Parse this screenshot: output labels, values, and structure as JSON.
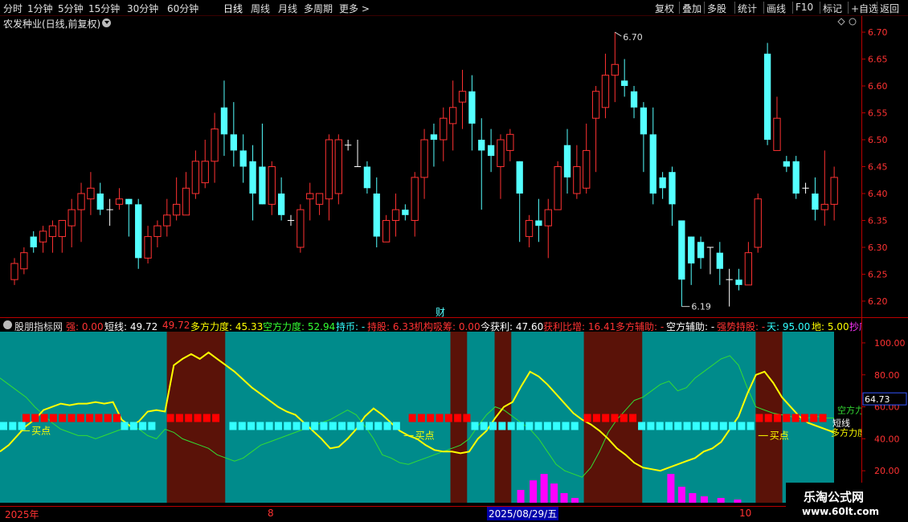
{
  "nav": [
    "分时",
    "1分钟",
    "5分钟",
    "15分钟",
    "30分钟",
    "60分钟",
    "日线",
    "周线",
    "月线",
    "多周期",
    "更多 >"
  ],
  "nav_active": "日线",
  "toolbar": [
    "复权",
    "叠加",
    "多股",
    "统计",
    "画线",
    "F10",
    "标记",
    "+自选",
    "返回"
  ],
  "stock_title": "农发种业(日线,前复权)",
  "price_axis": [
    "6.70",
    "6.65",
    "6.60",
    "6.55",
    "6.50",
    "6.45",
    "6.40",
    "6.35",
    "6.30",
    "6.25",
    "6.20"
  ],
  "price_annotations": {
    "high": "6.70",
    "low": "6.19"
  },
  "cai_marker": "财",
  "indicator_title": [
    {
      "text": "股朋指标网",
      "color": "#e0e0e0"
    },
    {
      "text": "强: 0.00",
      "color": "#ff3333"
    },
    {
      "text": "短线: 49.72",
      "color": "#ffffff"
    },
    {
      "text": "49.72",
      "color": "#ff3333"
    },
    {
      "text": "多方力度: 45.33",
      "color": "#ffff00"
    },
    {
      "text": "空方力度: 52.94",
      "color": "#33ff33"
    },
    {
      "text": "持币: -",
      "color": "#33ffff"
    },
    {
      "text": "持股: 6.33",
      "color": "#ff3333"
    },
    {
      "text": "机构吸筹: 0.00",
      "color": "#ff3333"
    },
    {
      "text": "今获利: 47.60",
      "color": "#ffffff"
    },
    {
      "text": "获利比增: 16.41",
      "color": "#ff3333"
    },
    {
      "text": "多方辅助: -",
      "color": "#ff3333"
    },
    {
      "text": "空方辅助: -",
      "color": "#ffffff"
    },
    {
      "text": "强势持股: -",
      "color": "#ff3333"
    },
    {
      "text": "天: 95.00",
      "color": "#33ffff"
    },
    {
      "text": "地: 5.00",
      "color": "#ffff00"
    },
    {
      "text": "抄底",
      "color": "#ff33ff"
    }
  ],
  "ind_axis": [
    "100.00",
    "80.00",
    "60.00",
    "40.00",
    "20.00"
  ],
  "ind_current": "64.73",
  "ind_labels": {
    "buy": "买点",
    "short": "短线",
    "bear": "空方力",
    "bull": "多方力度"
  },
  "date_axis": {
    "year": "2025年",
    "m8": "8",
    "m10": "10",
    "cursor": "2025/08/29/五"
  },
  "logo": {
    "line1": "乐淘公式网",
    "line2": "www.60lt.com"
  },
  "candles": [
    [
      6.24,
      6.27,
      6.28,
      6.23
    ],
    [
      6.26,
      6.29,
      6.3,
      6.25
    ],
    [
      6.32,
      6.3,
      6.33,
      6.29
    ],
    [
      6.31,
      6.33,
      6.34,
      6.29
    ],
    [
      6.32,
      6.34,
      6.35,
      6.29
    ],
    [
      6.32,
      6.35,
      6.35,
      6.29
    ],
    [
      6.34,
      6.37,
      6.39,
      6.3
    ],
    [
      6.37,
      6.4,
      6.42,
      6.31
    ],
    [
      6.39,
      6.41,
      6.44,
      6.36
    ],
    [
      6.4,
      6.37,
      6.42,
      6.36
    ],
    [
      6.37,
      6.37,
      6.39,
      6.34
    ],
    [
      6.38,
      6.39,
      6.41,
      6.37
    ],
    [
      6.39,
      6.38,
      6.39,
      6.32
    ],
    [
      6.38,
      6.28,
      6.39,
      6.26
    ],
    [
      6.28,
      6.32,
      6.34,
      6.27
    ],
    [
      6.32,
      6.34,
      6.35,
      6.3
    ],
    [
      6.34,
      6.36,
      6.39,
      6.32
    ],
    [
      6.36,
      6.38,
      6.43,
      6.35
    ],
    [
      6.36,
      6.41,
      6.44,
      6.36
    ],
    [
      6.4,
      6.46,
      6.48,
      6.39
    ],
    [
      6.42,
      6.46,
      6.5,
      6.41
    ],
    [
      6.46,
      6.52,
      6.55,
      6.42
    ],
    [
      6.56,
      6.51,
      6.61,
      6.47
    ],
    [
      6.51,
      6.48,
      6.57,
      6.45
    ],
    [
      6.48,
      6.45,
      6.51,
      6.42
    ],
    [
      6.46,
      6.4,
      6.49,
      6.35
    ],
    [
      6.45,
      6.38,
      6.53,
      6.38
    ],
    [
      6.38,
      6.45,
      6.46,
      6.36
    ],
    [
      6.4,
      6.36,
      6.43,
      6.35
    ],
    [
      6.35,
      6.35,
      6.36,
      6.34
    ],
    [
      6.3,
      6.37,
      6.38,
      6.29
    ],
    [
      6.39,
      6.4,
      6.42,
      6.35
    ],
    [
      6.38,
      6.4,
      6.4,
      6.36
    ],
    [
      6.39,
      6.5,
      6.51,
      6.35
    ],
    [
      6.4,
      6.5,
      6.51,
      6.38
    ],
    [
      6.49,
      6.49,
      6.5,
      6.48
    ],
    [
      6.45,
      6.45,
      6.5,
      6.45
    ],
    [
      6.45,
      6.41,
      6.46,
      6.4
    ],
    [
      6.4,
      6.32,
      6.43,
      6.3
    ],
    [
      6.31,
      6.35,
      6.36,
      6.31
    ],
    [
      6.35,
      6.37,
      6.4,
      6.32
    ],
    [
      6.37,
      6.36,
      6.38,
      6.35
    ],
    [
      6.35,
      6.43,
      6.44,
      6.32
    ],
    [
      6.43,
      6.5,
      6.52,
      6.39
    ],
    [
      6.51,
      6.5,
      6.53,
      6.45
    ],
    [
      6.5,
      6.54,
      6.56,
      6.46
    ],
    [
      6.53,
      6.56,
      6.61,
      6.48
    ],
    [
      6.57,
      6.59,
      6.63,
      6.52
    ],
    [
      6.59,
      6.53,
      6.62,
      6.48
    ],
    [
      6.5,
      6.48,
      6.54,
      6.37
    ],
    [
      6.49,
      6.47,
      6.52,
      6.44
    ],
    [
      6.45,
      6.5,
      6.51,
      6.39
    ],
    [
      6.48,
      6.51,
      6.52,
      6.46
    ],
    [
      6.46,
      6.4,
      6.46,
      6.31
    ],
    [
      6.32,
      6.35,
      6.36,
      6.3
    ],
    [
      6.35,
      6.34,
      6.39,
      6.31
    ],
    [
      6.34,
      6.37,
      6.39,
      6.28
    ],
    [
      6.37,
      6.45,
      6.46,
      6.37
    ],
    [
      6.49,
      6.43,
      6.52,
      6.4
    ],
    [
      6.4,
      6.45,
      6.49,
      6.39
    ],
    [
      6.41,
      6.48,
      6.53,
      6.4
    ],
    [
      6.54,
      6.59,
      6.6,
      6.44
    ],
    [
      6.56,
      6.62,
      6.66,
      6.54
    ],
    [
      6.62,
      6.64,
      6.7,
      6.57
    ],
    [
      6.61,
      6.6,
      6.65,
      6.58
    ],
    [
      6.59,
      6.56,
      6.6,
      6.54
    ],
    [
      6.56,
      6.51,
      6.57,
      6.44
    ],
    [
      6.51,
      6.4,
      6.56,
      6.38
    ],
    [
      6.43,
      6.41,
      6.44,
      6.39
    ],
    [
      6.44,
      6.38,
      6.45,
      6.34
    ],
    [
      6.35,
      6.24,
      6.35,
      6.19
    ],
    [
      6.32,
      6.27,
      6.32,
      6.23
    ],
    [
      6.31,
      6.28,
      6.32,
      6.26
    ],
    [
      6.3,
      6.3,
      6.3,
      6.25
    ],
    [
      6.29,
      6.26,
      6.31,
      6.23
    ],
    [
      6.24,
      6.24,
      6.26,
      6.19
    ],
    [
      6.24,
      6.23,
      6.26,
      6.22
    ],
    [
      6.23,
      6.29,
      6.31,
      6.23
    ],
    [
      6.3,
      6.39,
      6.4,
      6.29
    ],
    [
      6.66,
      6.5,
      6.68,
      6.49
    ],
    [
      6.48,
      6.54,
      6.58,
      6.49
    ],
    [
      6.46,
      6.45,
      6.47,
      6.44
    ],
    [
      6.46,
      6.4,
      6.47,
      6.39
    ],
    [
      6.41,
      6.41,
      6.42,
      6.4
    ],
    [
      6.4,
      6.37,
      6.43,
      6.35
    ],
    [
      6.37,
      6.38,
      6.48,
      6.34
    ],
    [
      6.38,
      6.43,
      6.45,
      6.35
    ]
  ],
  "indicator": {
    "short_line": [
      34,
      38,
      42,
      47,
      50,
      53,
      58,
      63,
      65,
      65,
      66,
      65,
      64,
      65,
      60,
      55,
      52,
      50,
      48,
      47,
      47,
      48,
      50,
      54,
      57,
      56,
      54,
      52,
      48,
      44,
      40,
      37,
      36,
      36,
      38,
      42,
      46,
      50,
      50,
      51,
      54,
      57,
      64,
      68,
      74,
      76,
      75,
      70,
      62,
      58,
      55,
      55,
      50,
      38,
      28,
      25,
      24,
      25,
      28,
      32,
      36,
      40,
      46,
      56,
      70,
      75,
      80,
      82,
      78,
      68,
      58,
      50,
      44,
      40,
      35,
      30,
      24,
      20,
      18,
      16,
      14,
      13,
      14,
      18,
      24,
      30,
      42,
      48,
      50,
      52,
      50,
      48,
      46,
      44,
      44,
      46,
      48
    ],
    "bull_line": [
      32,
      36,
      42,
      48,
      52,
      58,
      60,
      62,
      61,
      62,
      62,
      63,
      62,
      63,
      52,
      48,
      51,
      57,
      58,
      57,
      86,
      90,
      93,
      90,
      94,
      90,
      86,
      82,
      77,
      72,
      68,
      64,
      60,
      57,
      55,
      50,
      45,
      40,
      34,
      35,
      40,
      46,
      54,
      59,
      55,
      50,
      45,
      42,
      40,
      36,
      33,
      32,
      32,
      31,
      32,
      40,
      45,
      53,
      60,
      63,
      73,
      82,
      79,
      74,
      68,
      62,
      56,
      52,
      49,
      45,
      40,
      34,
      30,
      25,
      22,
      21,
      20,
      22,
      24,
      26,
      28,
      32,
      34,
      38,
      46,
      54,
      68,
      80,
      82,
      75,
      66,
      60,
      54,
      50,
      48,
      46,
      44
    ],
    "bear_line": [
      78,
      74,
      70,
      66,
      60,
      55,
      50,
      46,
      44,
      42,
      42,
      40,
      42,
      44,
      46,
      48,
      46,
      42,
      40,
      46,
      44,
      40,
      38,
      36,
      34,
      30,
      28,
      26,
      28,
      32,
      36,
      38,
      40,
      42,
      44,
      46,
      48,
      50,
      52,
      55,
      58,
      55,
      48,
      40,
      30,
      28,
      25,
      24,
      26,
      28,
      30,
      32,
      34,
      36,
      40,
      48,
      55,
      60,
      58,
      54,
      50,
      46,
      40,
      32,
      24,
      20,
      18,
      16,
      22,
      32,
      44,
      52,
      58,
      64,
      66,
      70,
      74,
      76,
      70,
      72,
      78,
      82,
      86,
      90,
      92,
      86,
      72,
      60,
      58,
      56,
      55,
      54,
      52,
      53,
      54,
      53,
      53
    ],
    "bands": [
      [
        0.2,
        0.27
      ],
      [
        0.54,
        0.56
      ],
      [
        0.593,
        0.613
      ],
      [
        0.7,
        0.77
      ],
      [
        0.906,
        0.938
      ]
    ],
    "red_squares_ranges": [
      [
        0.027,
        0.14
      ],
      [
        0.2,
        0.26
      ],
      [
        0.49,
        0.56
      ],
      [
        0.7,
        0.76
      ],
      [
        0.906,
        0.99
      ]
    ],
    "cyan_squares_ranges": [
      [
        0,
        0.027
      ],
      [
        0.145,
        0.19
      ],
      [
        0.275,
        0.48
      ],
      [
        0.565,
        0.69
      ],
      [
        0.765,
        0.9
      ]
    ],
    "magenta_bars": [
      [
        0.62,
        8
      ],
      [
        0.635,
        14
      ],
      [
        0.648,
        18
      ],
      [
        0.66,
        12
      ],
      [
        0.672,
        6
      ],
      [
        0.685,
        3
      ],
      [
        0.8,
        18
      ],
      [
        0.813,
        10
      ],
      [
        0.826,
        6
      ],
      [
        0.84,
        4
      ],
      [
        0.86,
        3
      ],
      [
        0.88,
        2
      ]
    ]
  }
}
